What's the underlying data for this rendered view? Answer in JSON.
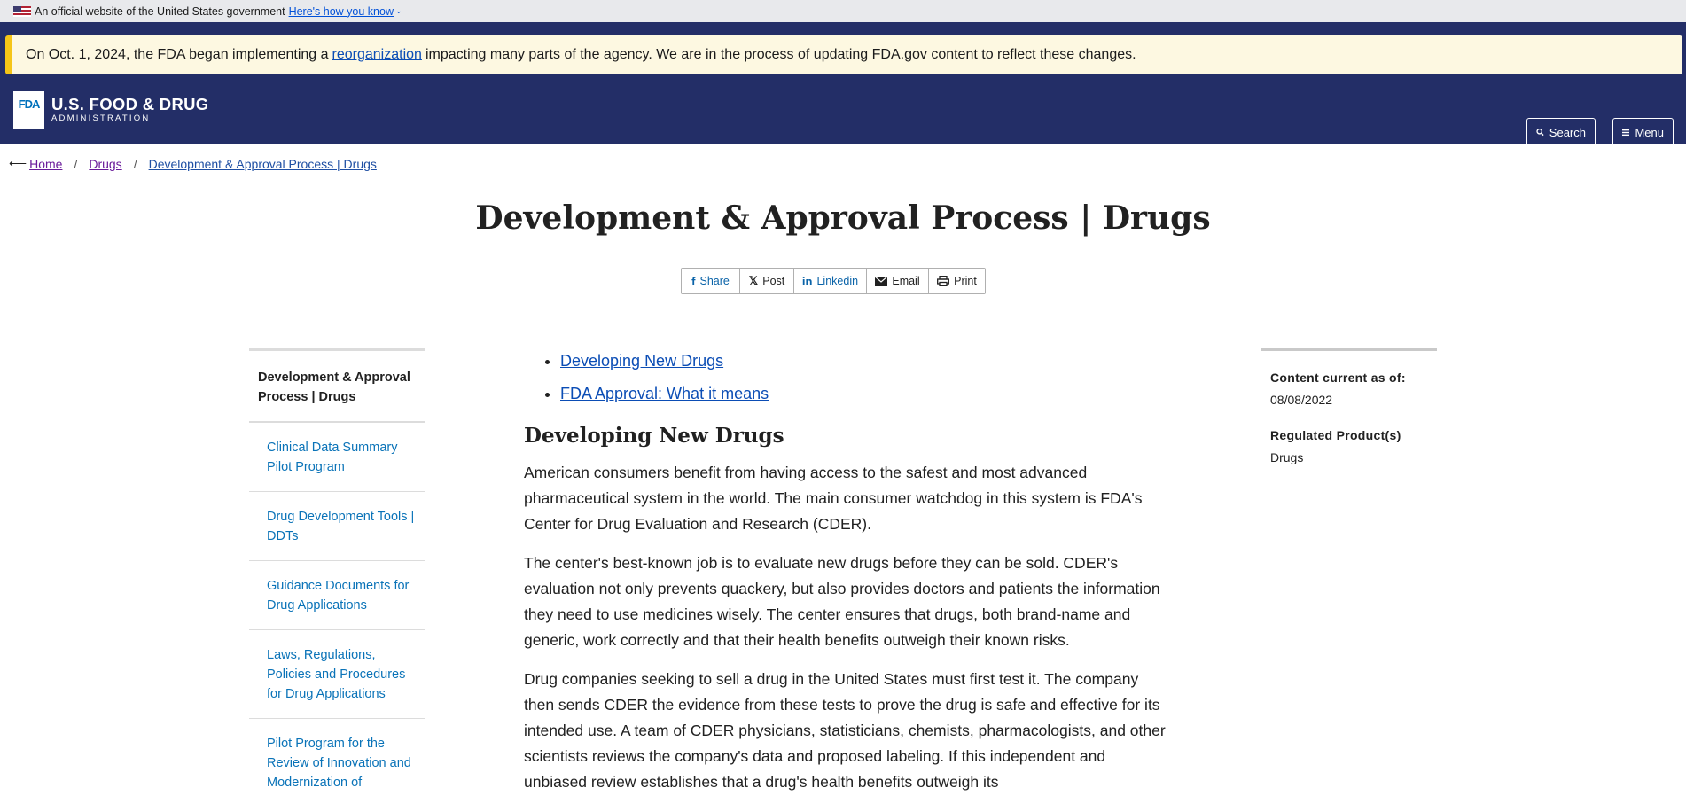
{
  "gov_banner": {
    "text": "An official website of the United States government",
    "link": "Here's how you know"
  },
  "alert": {
    "before": "On Oct. 1, 2024, the FDA began implementing a",
    "link": "reorganization",
    "after": "impacting many parts of the agency. We are in the process of updating FDA.gov content to reflect these changes."
  },
  "logo": {
    "mark": "FDA",
    "main": "U.S. FOOD & DRUG",
    "sub": "ADMINISTRATION"
  },
  "header_buttons": {
    "search": "Search",
    "menu": "Menu"
  },
  "breadcrumb": {
    "home": "Home",
    "drugs": "Drugs",
    "current": "Development & Approval Process | Drugs"
  },
  "page_title": "Development & Approval Process | Drugs",
  "share": {
    "share": "Share",
    "post": "Post",
    "linkedin": "Linkedin",
    "email": "Email",
    "print": "Print"
  },
  "left_nav": {
    "heading": "Development & Approval Process | Drugs",
    "items": [
      "Clinical Data Summary Pilot Program",
      "Drug Development Tools | DDTs",
      "Guidance Documents for Drug Applications",
      "Laws, Regulations, Policies and Procedures for Drug Applications",
      "Pilot Program for the Review of Innovation and Modernization of Excipients (PRIME)"
    ]
  },
  "main": {
    "toc": [
      "Developing New Drugs",
      "FDA Approval: What it means"
    ],
    "section_heading": "Developing New Drugs",
    "paragraphs": [
      "American consumers benefit from having access to the safest and most advanced pharmaceutical system in the world. The main consumer watchdog in this system is FDA's Center for Drug Evaluation and Research (CDER).",
      "The center's best-known job is to evaluate new drugs before they can be sold. CDER's evaluation not only prevents quackery, but also provides doctors and patients the information they need to use medicines wisely. The center ensures that drugs, both brand-name and generic, work correctly and that their health benefits outweigh their known risks.",
      "Drug companies seeking to sell a drug in the United States must first test it. The company then sends CDER the evidence from these tests to prove the drug is safe and effective for its intended use. A team of CDER physicians, statisticians, chemists, pharmacologists, and other scientists reviews the company's data and proposed labeling. If this independent and unbiased review establishes that a drug's health benefits outweigh its"
    ]
  },
  "right_side": {
    "content_label": "Content current as of:",
    "content_date": "08/08/2022",
    "regulated_label": "Regulated Product(s)",
    "regulated_value": "Drugs"
  }
}
